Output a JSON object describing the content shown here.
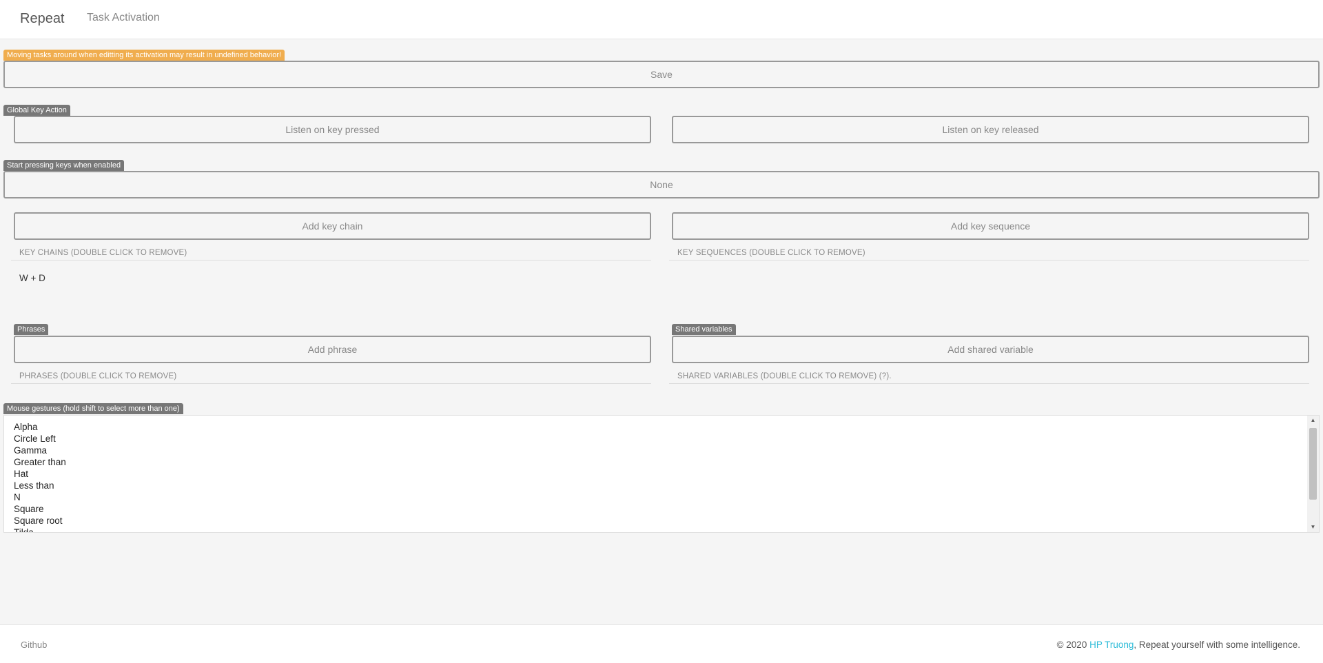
{
  "navbar": {
    "brand": "Repeat",
    "link": "Task Activation"
  },
  "warning": {
    "text": "Moving tasks around when editting its activation may result in undefined behavior!",
    "save_label": "Save"
  },
  "global_key_action": {
    "label": "Global Key Action",
    "pressed_label": "Listen on key pressed",
    "released_label": "Listen on key released"
  },
  "start_pressing": {
    "label": "Start pressing keys when enabled",
    "value": "None"
  },
  "key_chains": {
    "add_label": "Add key chain",
    "header": "KEY CHAINS (DOUBLE CLICK TO REMOVE)",
    "items": [
      "W + D"
    ]
  },
  "key_sequences": {
    "add_label": "Add key sequence",
    "header": "KEY SEQUENCES (DOUBLE CLICK TO REMOVE)",
    "items": []
  },
  "phrases": {
    "label": "Phrases",
    "add_label": "Add phrase",
    "header": "PHRASES (DOUBLE CLICK TO REMOVE)"
  },
  "shared_variables": {
    "label": "Shared variables",
    "add_label": "Add shared variable",
    "header": "SHARED VARIABLES (DOUBLE CLICK TO REMOVE) (?)."
  },
  "mouse_gestures": {
    "label": "Mouse gestures (hold shift to select more than one)",
    "options": [
      "Alpha",
      "Circle Left",
      "Gamma",
      "Greater than",
      "Hat",
      "Less than",
      "N",
      "Square",
      "Square root",
      "Tilda"
    ]
  },
  "footer": {
    "github": "Github",
    "copyright_prefix": "© 2020 ",
    "author": "HP Truong",
    "copyright_suffix": ", Repeat yourself with some intelligence."
  },
  "colors": {
    "warning": "#f0ad4e",
    "label": "#777777",
    "link_accent": "#2bbbd8"
  },
  "icons": {
    "scroll_up": "triangle-up",
    "scroll_down": "triangle-down"
  }
}
